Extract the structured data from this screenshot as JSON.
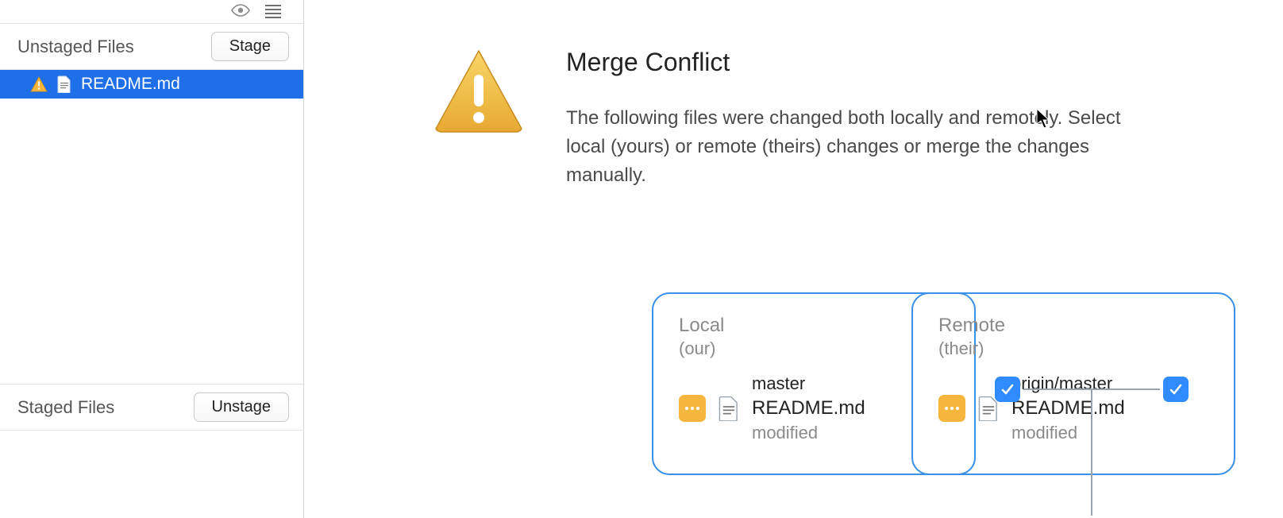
{
  "sidebar": {
    "unstaged_label": "Unstaged Files",
    "stage_button": "Stage",
    "staged_label": "Staged Files",
    "unstage_button": "Unstage",
    "files": [
      {
        "name": "README.md"
      }
    ]
  },
  "main": {
    "title": "Merge Conflict",
    "body": "The following files were changed both locally and remotely. Select local (yours) or remote (theirs) changes or merge the changes manually."
  },
  "merge": {
    "local": {
      "label": "Local",
      "sub": "(our)",
      "branch": "master",
      "file": "README.md",
      "status": "modified"
    },
    "remote": {
      "label": "Remote",
      "sub": "(their)",
      "branch": "origin/master",
      "file": "README.md",
      "status": "modified"
    }
  }
}
